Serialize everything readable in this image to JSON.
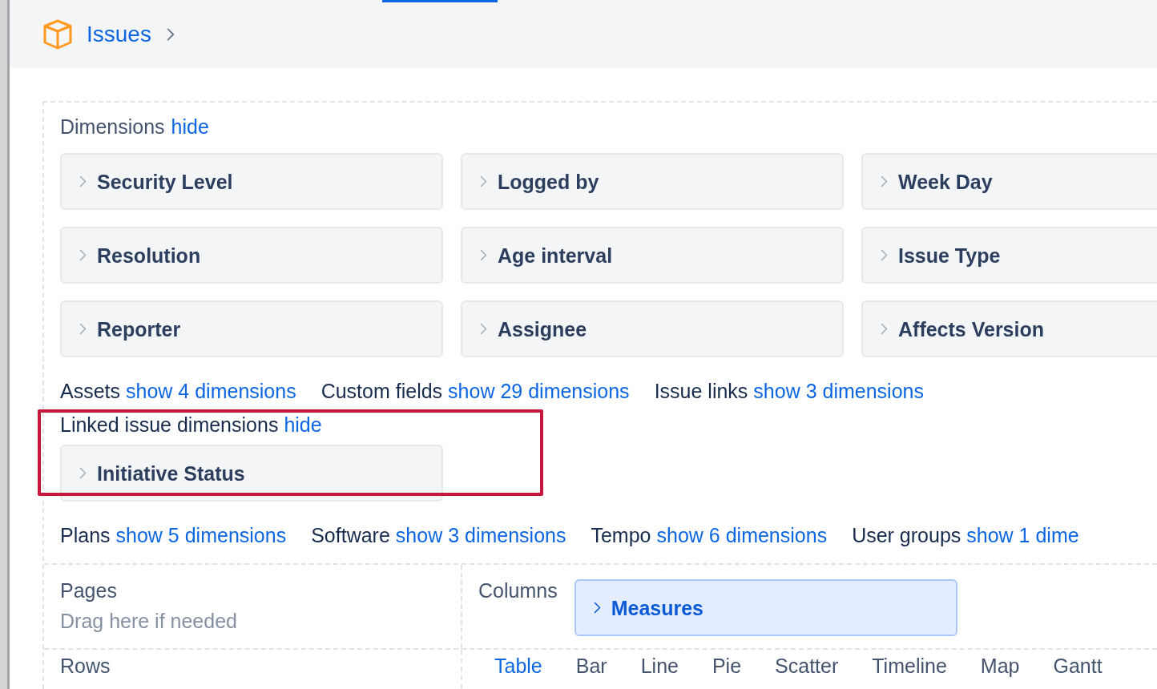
{
  "header": {
    "title": "Issues"
  },
  "dimensions": {
    "title": "Dimensions",
    "toggle": "hide",
    "items": [
      "Security Level",
      "Logged by",
      "Week Day",
      "Resolution",
      "Age interval",
      "Issue Type",
      "Reporter",
      "Assignee",
      "Affects Version"
    ]
  },
  "dimension_groups": [
    {
      "label": "Assets",
      "toggle": "show 4 dimensions",
      "highlighted": false
    },
    {
      "label": "Custom fields",
      "toggle": "show 29 dimensions",
      "highlighted": false
    },
    {
      "label": "Issue links",
      "toggle": "show 3 dimensions",
      "highlighted": false
    },
    {
      "label": "Linked issue dimensions",
      "toggle": "hide",
      "highlighted": true,
      "items": [
        "Initiative Status"
      ]
    },
    {
      "label": "Plans",
      "toggle": "show 5 dimensions",
      "highlighted": false
    },
    {
      "label": "Software",
      "toggle": "show 3 dimensions",
      "highlighted": false
    },
    {
      "label": "Tempo",
      "toggle": "show 6 dimensions",
      "highlighted": false
    },
    {
      "label": "User groups",
      "toggle": "show 1 dime",
      "highlighted": false
    }
  ],
  "pages": {
    "title": "Pages",
    "hint": "Drag here if needed"
  },
  "columns": {
    "title": "Columns",
    "items": [
      "Measures"
    ]
  },
  "rows": {
    "title": "Rows"
  },
  "chart_types": [
    {
      "label": "Table",
      "selected": true
    },
    {
      "label": "Bar",
      "selected": false
    },
    {
      "label": "Line",
      "selected": false
    },
    {
      "label": "Pie",
      "selected": false
    },
    {
      "label": "Scatter",
      "selected": false
    },
    {
      "label": "Timeline",
      "selected": false
    },
    {
      "label": "Map",
      "selected": false
    },
    {
      "label": "Gantt",
      "selected": false
    }
  ]
}
